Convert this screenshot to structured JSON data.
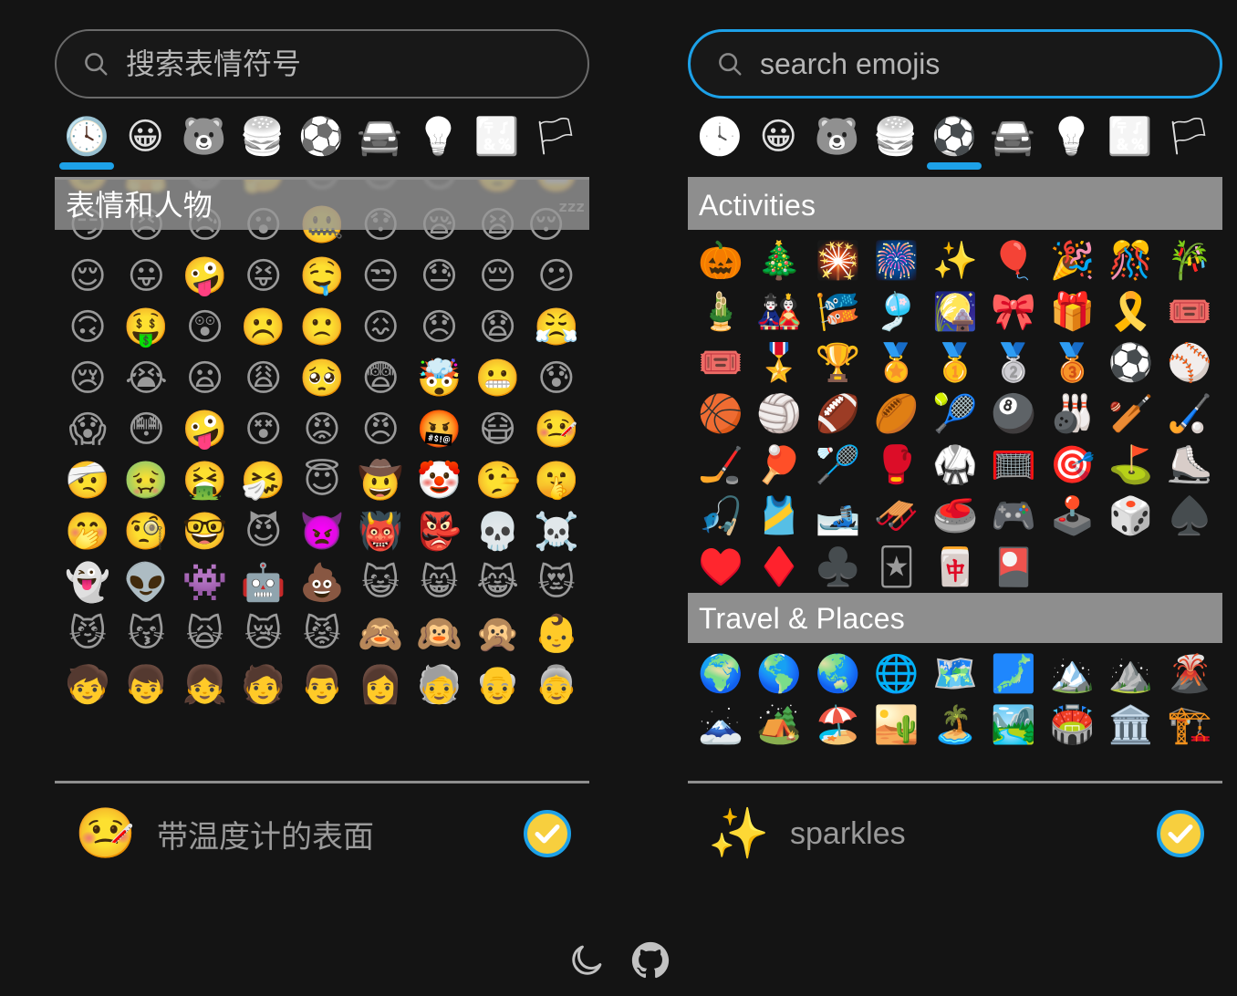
{
  "theme": {
    "background": "#141414",
    "accent": "#1da1e8",
    "header_bg": "#8e8e8e",
    "text_muted": "#9a9a9a",
    "text_bright": "#ffffff",
    "check_fill": "#f7cf3e"
  },
  "panels": [
    {
      "id": "left",
      "search": {
        "placeholder": "搜索表情符号",
        "value": "",
        "focused": false,
        "icon": "search-icon"
      },
      "tabs": [
        {
          "label": "recent",
          "glyph": "🕓",
          "active": false
        },
        {
          "label": "smileys",
          "glyph": "😀",
          "active": true
        },
        {
          "label": "animals",
          "glyph": "🐻",
          "active": false
        },
        {
          "label": "food",
          "glyph": "🍔",
          "active": false
        },
        {
          "label": "activities",
          "glyph": "⚽",
          "active": false
        },
        {
          "label": "travel",
          "glyph": "🚘",
          "active": false
        },
        {
          "label": "objects",
          "glyph": "💡",
          "active": false
        },
        {
          "label": "symbols",
          "glyph": "🔣",
          "active": false
        },
        {
          "label": "flags",
          "glyph": "🏳",
          "active": false
        }
      ],
      "categories": [
        {
          "title": "表情和人物",
          "sticky": true,
          "emojis": [
            "🙂",
            "🤗",
            "😃",
            "🤔",
            "😐",
            "😑",
            "😶",
            "🙄",
            "😬",
            "😏",
            "😣",
            "😥",
            "😮",
            "🤐",
            "😯",
            "😪",
            "😫",
            "😴",
            "😌",
            "😛",
            "🤪",
            "😝",
            "🤤",
            "😒",
            "😓",
            "😔",
            "😕",
            "🙃",
            "🤑",
            "😲",
            "☹️",
            "🙁",
            "😖",
            "😞",
            "😧",
            "😤",
            "😢",
            "😭",
            "😦",
            "😩",
            "🥺",
            "😨",
            "🤯",
            "😬",
            "😰",
            "😱",
            "😳",
            "🤪",
            "😵",
            "😡",
            "😠",
            "🤬",
            "😷",
            "🤒",
            "🤕",
            "🤢",
            "🤮",
            "🤧",
            "😇",
            "🤠",
            "🤡",
            "🤥",
            "🤫",
            "🤭",
            "🧐",
            "🤓",
            "😈",
            "👿",
            "👹",
            "👺",
            "💀",
            "☠️",
            "👻",
            "👽",
            "👾",
            "🤖",
            "💩",
            "😺",
            "😸",
            "😹",
            "😻",
            "😼",
            "😽",
            "🙀",
            "😿",
            "😾",
            "🙈",
            "🙉",
            "🙊",
            "👶",
            "🧒",
            "👦",
            "👧",
            "🧑",
            "👨",
            "👩",
            "🧓",
            "👴",
            "👵"
          ]
        }
      ],
      "status": {
        "emoji": "🤒",
        "name": "带温度计的表面",
        "copy_icon": "check-circle-icon"
      }
    },
    {
      "id": "right",
      "search": {
        "placeholder": "search emojis",
        "value": "",
        "focused": true,
        "icon": "search-icon"
      },
      "tabs": [
        {
          "label": "recent",
          "glyph": "🕓",
          "active": false
        },
        {
          "label": "smileys",
          "glyph": "😀",
          "active": false
        },
        {
          "label": "animals",
          "glyph": "🐻",
          "active": false
        },
        {
          "label": "food",
          "glyph": "🍔",
          "active": false
        },
        {
          "label": "activities",
          "glyph": "⚽",
          "active": true
        },
        {
          "label": "travel",
          "glyph": "🚘",
          "active": false
        },
        {
          "label": "objects",
          "glyph": "💡",
          "active": false
        },
        {
          "label": "symbols",
          "glyph": "🔣",
          "active": false
        },
        {
          "label": "flags",
          "glyph": "🏳",
          "active": false
        }
      ],
      "categories": [
        {
          "title": "Activities",
          "sticky": false,
          "emojis": [
            "🎃",
            "🎄",
            "🎇",
            "🎆",
            "✨",
            "🎈",
            "🎉",
            "🎊",
            "🎋",
            "🎍",
            "🎎",
            "🎏",
            "🎐",
            "🎑",
            "🎀",
            "🎁",
            "🎗️",
            "🎟️",
            "🎟️",
            "🎖️",
            "🏆",
            "🏅",
            "🥇",
            "🥈",
            "🥉",
            "⚽",
            "⚾",
            "🏀",
            "🏐",
            "🏈",
            "🏉",
            "🎾",
            "🎱",
            "🎳",
            "🏏",
            "🏑",
            "🏒",
            "🏓",
            "🏸",
            "🥊",
            "🥋",
            "🥅",
            "🎯",
            "⛳",
            "⛸️",
            "🎣",
            "🎽",
            "🎿",
            "🛷",
            "🥌",
            "🎮",
            "🕹️",
            "🎲",
            "♠️",
            "♥️",
            "♦️",
            "♣️",
            "🃏",
            "🀄",
            "🎴"
          ]
        },
        {
          "title": "Travel & Places",
          "sticky": false,
          "emojis": [
            "🌍",
            "🌎",
            "🌏",
            "🌐",
            "🗺️",
            "🗾",
            "🏔️",
            "⛰️",
            "🌋",
            "🗻",
            "🏕️",
            "🏖️",
            "🏜️",
            "🏝️",
            "🏞️",
            "🏟️",
            "🏛️",
            "🏗️"
          ]
        }
      ],
      "status": {
        "emoji": "✨",
        "name": "sparkles",
        "copy_icon": "check-circle-icon"
      }
    }
  ],
  "footer": {
    "items": [
      {
        "name": "dark-mode-toggle",
        "icon": "moon-icon"
      },
      {
        "name": "github-link",
        "icon": "github-icon"
      }
    ]
  }
}
